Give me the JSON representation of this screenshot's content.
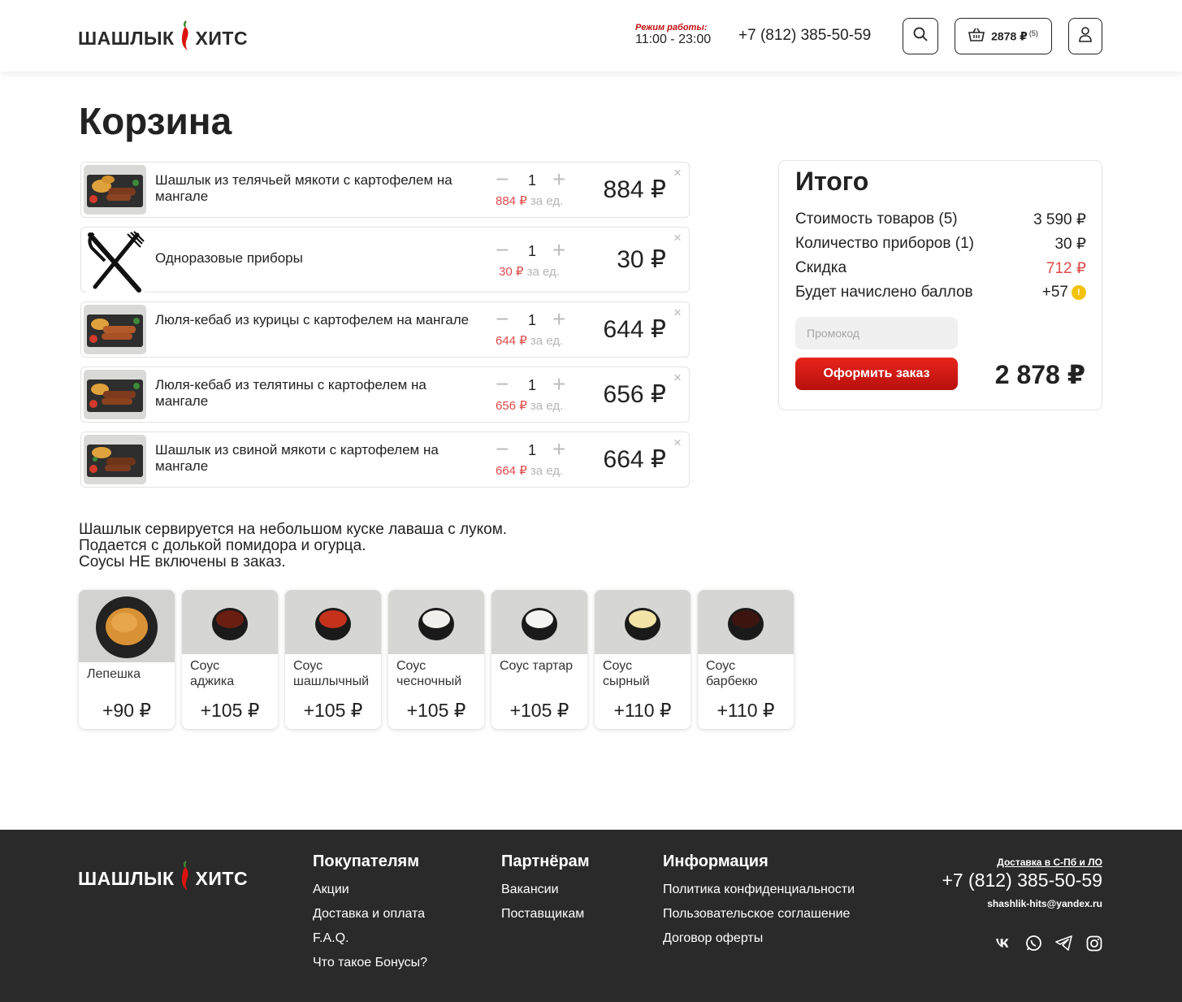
{
  "brand": {
    "left": "ШАШЛЫК",
    "right": "ХИТС"
  },
  "header": {
    "hours_label": "Режим работы:",
    "hours_value": "11:00 - 23:00",
    "phone": "+7 (812) 385-50-59",
    "cart_total": "2878 ₽",
    "cart_count": "(5)"
  },
  "page_title": "Корзина",
  "cart": {
    "items": [
      {
        "name": "Шашлык из телячьей мякоти с картофелем на мангале",
        "qty": "1",
        "unit_price": "884 ₽",
        "unit_suffix": "за ед.",
        "total": "884 ₽"
      },
      {
        "name": "Одноразовые приборы",
        "qty": "1",
        "unit_price": "30 ₽",
        "unit_suffix": "за ед.",
        "total": "30 ₽"
      },
      {
        "name": "Люля-кебаб из курицы с картофелем на мангале",
        "qty": "1",
        "unit_price": "644 ₽",
        "unit_suffix": "за ед.",
        "total": "644 ₽"
      },
      {
        "name": "Люля-кебаб из телятины с картофелем на мангале",
        "qty": "1",
        "unit_price": "656 ₽",
        "unit_suffix": "за ед.",
        "total": "656 ₽"
      },
      {
        "name": "Шашлык из свиной мякоти с картофелем на мангале",
        "qty": "1",
        "unit_price": "664 ₽",
        "unit_suffix": "за ед.",
        "total": "664 ₽"
      }
    ],
    "minus": "−",
    "plus": "+",
    "remove": "×"
  },
  "summary": {
    "title": "Итого",
    "rows": [
      {
        "label": "Стоимость товаров (5)",
        "value": "3 590 ₽"
      },
      {
        "label": "Количество приборов (1)",
        "value": "30 ₽"
      },
      {
        "label": "Скидка",
        "value": "712 ₽"
      },
      {
        "label": "Будет начислено баллов",
        "value": "+57"
      }
    ],
    "coin_symbol": "!",
    "promo_placeholder": "Промокод",
    "order_button": "Оформить заказ",
    "total": "2 878 ₽"
  },
  "note": {
    "line1": "Шашлык сервируется на небольшом куске лаваша с луком.",
    "line2": "Подается с долькой помидора и огурца.",
    "line3": "Соусы НЕ включены в заказ."
  },
  "addons": [
    {
      "name": "Лепешка",
      "price": "+90 ₽"
    },
    {
      "name": "Соус аджика",
      "price": "+105 ₽"
    },
    {
      "name": "Соус шашлычный",
      "price": "+105 ₽"
    },
    {
      "name": "Соус чесночный",
      "price": "+105 ₽"
    },
    {
      "name": "Соус тартар",
      "price": "+105 ₽"
    },
    {
      "name": "Соус сырный",
      "price": "+110 ₽"
    },
    {
      "name": "Соус барбекю",
      "price": "+110 ₽"
    }
  ],
  "footer": {
    "buyers": {
      "title": "Покупателям",
      "links": [
        "Акции",
        "Доставка и оплата",
        "F.A.Q.",
        "Что такое Бонусы?"
      ]
    },
    "partners": {
      "title": "Партнёрам",
      "links": [
        "Вакансии",
        "Поставщикам"
      ]
    },
    "info": {
      "title": "Информация",
      "links": [
        "Политика конфиденциальности",
        "Пользовательское соглашение",
        "Договор оферты"
      ]
    },
    "delivery": "Доставка в С-Пб и ЛО",
    "phone": "+7 (812) 385-50-59",
    "email": "shashlik-hits@yandex.ru"
  },
  "icons": {
    "search": "search-icon",
    "cart": "basket-icon",
    "user": "user-icon",
    "vk": "vk-icon",
    "whatsapp": "whatsapp-icon",
    "telegram": "telegram-icon",
    "instagram": "instagram-icon"
  },
  "colors": {
    "brand_red": "#c30f0f",
    "discount_red": "#e04a4a",
    "coin": "#f2c20d",
    "footer_bg": "#2a2a2a"
  }
}
